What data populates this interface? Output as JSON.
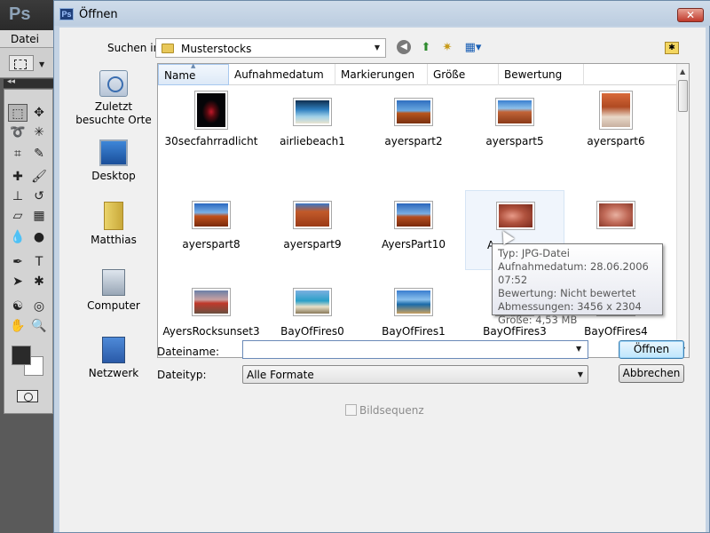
{
  "photoshop": {
    "logo": "Ps",
    "menu_file": "Datei"
  },
  "dialog": {
    "title": "Öffnen",
    "look_in_label": "Suchen in:",
    "look_in_value": "Musterstocks",
    "places": [
      {
        "label": "Zuletzt besuchte Orte",
        "icon": "recent-places-icon"
      },
      {
        "label": "Desktop",
        "icon": "desktop-icon"
      },
      {
        "label": "Matthias",
        "icon": "user-folder-icon"
      },
      {
        "label": "Computer",
        "icon": "computer-icon"
      },
      {
        "label": "Netzwerk",
        "icon": "network-icon"
      }
    ],
    "columns": [
      "Name",
      "Aufnahmedatum",
      "Markierungen",
      "Größe",
      "Bewertung"
    ],
    "files": [
      "30secfahrradlicht",
      "airliebeach1",
      "ayerspart2",
      "ayerspart5",
      "ayerspart6",
      "ayerspart8",
      "ayerspart9",
      "AyersPart10",
      "A",
      "",
      "AyersRocksunset3",
      "BayOfFires0",
      "BayOfFires1",
      "BayOfFires3",
      "BayOfFires4"
    ],
    "tooltip": {
      "type": "Typ: JPG-Datei",
      "date": "Aufnahmedatum: 28.06.2006 07:52",
      "rating": "Bewertung: Nicht bewertet",
      "dimensions": "Abmessungen: 3456 x 2304",
      "size": "Größe: 4,53 MB"
    },
    "filename_label": "Dateiname:",
    "filename_value": "",
    "filetype_label": "Dateityp:",
    "filetype_value": "Alle Formate",
    "open_button": "Öffnen",
    "cancel_button": "Abbrechen",
    "image_sequence_label": "Bildsequenz"
  }
}
